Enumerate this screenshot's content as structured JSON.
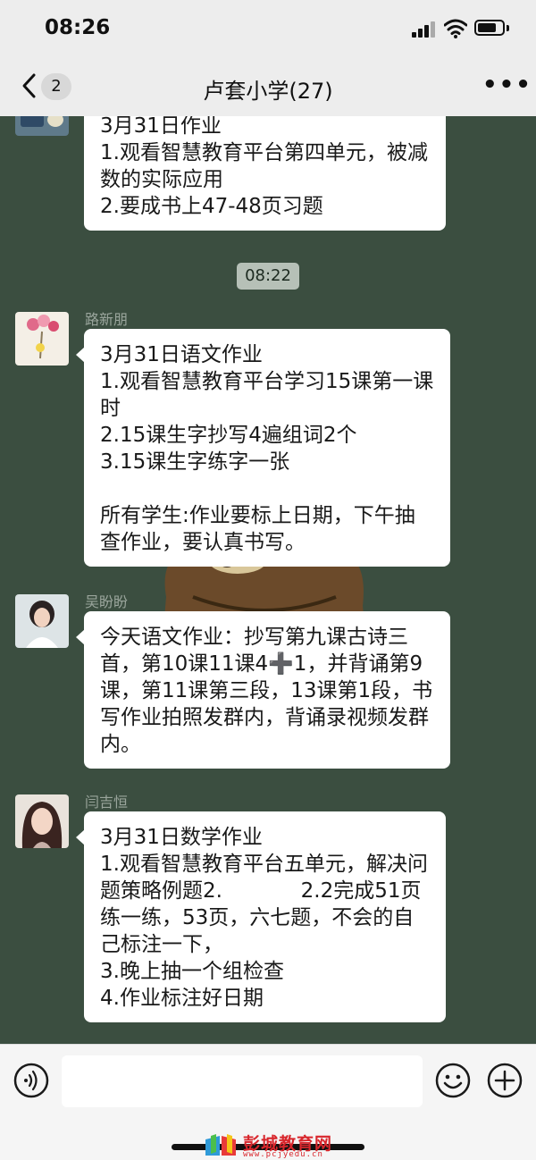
{
  "status": {
    "time": "08:26"
  },
  "header": {
    "unread_count": "2",
    "title": "卢套小学(27)",
    "more": "•••"
  },
  "messages": {
    "m0_text": "3月31日作业\n1.观看智慧教育平台第四单元，被减数的实际应用\n2.要成书上47-48页习题",
    "timestamp": "08:22",
    "m1_sender": "路新朋",
    "m1_text": "3月31日语文作业\n1.观看智慧教育平台学习15课第一课时\n2.15课生字抄写4遍组词2个\n3.15课生字练字一张\n\n所有学生:作业要标上日期，下午抽查作业，要认真书写。",
    "m2_sender": "吴盼盼",
    "m2_text": "今天语文作业：抄写第九课古诗三首，第10课11课4➕1，并背诵第9课，第11课第三段，13课第1段，书写作业拍照发群内，背诵录视频发群内。",
    "m3_sender": "闫吉恒",
    "m3_text": "3月31日数学作业\n1.观看智慧教育平台五单元，解决问题策略例题2.            2.2完成51页练一练，53页，六七题，不会的自己标注一下，\n3.晚上抽一个组检查\n4.作业标注好日期"
  },
  "input": {
    "placeholder": ""
  },
  "watermark": {
    "title": "彭城教育网",
    "url": "www.pcjyedu.cn"
  },
  "colors": {
    "chat_bg": "#3b4e40",
    "bubble": "#ffffff",
    "bar_bg": "#ededed",
    "watermark": "#d8262c"
  },
  "icons": [
    "back-chevron-icon",
    "more-dots-icon",
    "signal-icon",
    "wifi-icon",
    "battery-icon",
    "voice-icon",
    "emoji-icon",
    "plus-icon"
  ]
}
